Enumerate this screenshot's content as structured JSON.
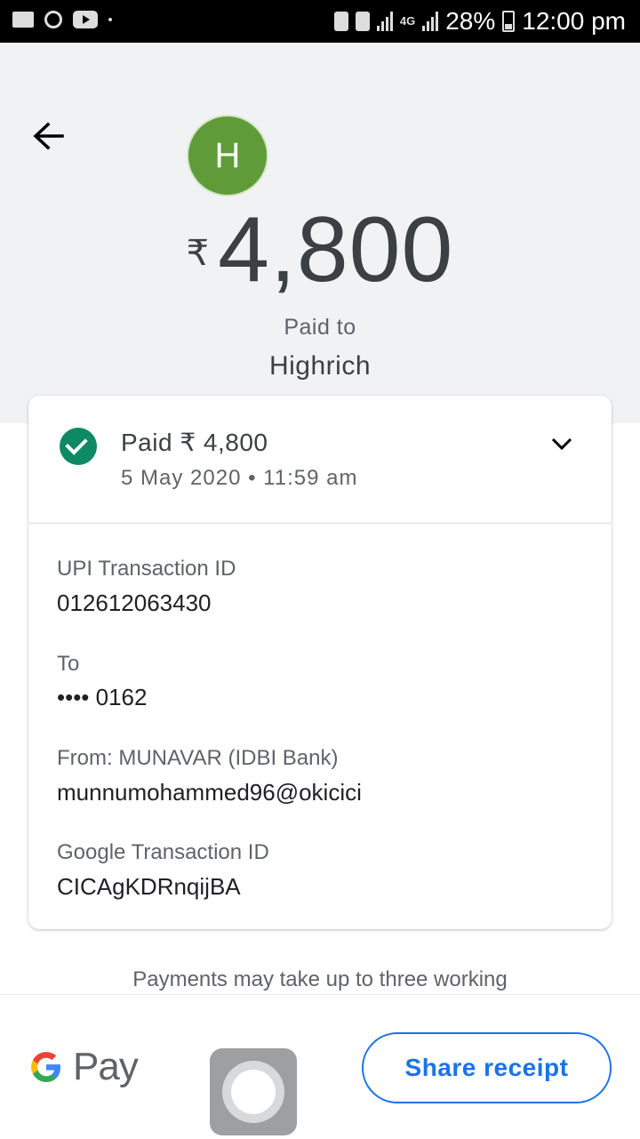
{
  "status_bar": {
    "battery": "28%",
    "time": "12:00 pm",
    "network": "4G"
  },
  "header": {
    "avatar_initial": "H",
    "currency_symbol": "₹",
    "amount": "4,800",
    "paid_to_label": "Paid to",
    "payee_name": "Highrich"
  },
  "card": {
    "status_title": "Paid ₹ 4,800",
    "status_date": "5 May 2020 • 11:59 am",
    "fields": [
      {
        "label": "UPI Transaction ID",
        "value": "012612063430"
      },
      {
        "label": "To",
        "value": "•••• 0162"
      },
      {
        "label": "From: MUNAVAR (IDBI Bank)",
        "value": "munnumohammed96@okicici"
      },
      {
        "label": "Google Transaction ID",
        "value": "CICAgKDRnqijBA"
      }
    ]
  },
  "note": "Payments may take up to three working",
  "bottom_bar": {
    "brand_text": "Pay",
    "share_label": "Share receipt"
  },
  "colors": {
    "avatar": "#5f9c39",
    "success": "#0d8a62",
    "accent": "#1a73e8",
    "header_bg": "#f1f2f4"
  },
  "icons": [
    "back-arrow-icon",
    "check-circle-icon",
    "chevron-down-icon",
    "google-g-icon",
    "assistive-touch-icon"
  ]
}
